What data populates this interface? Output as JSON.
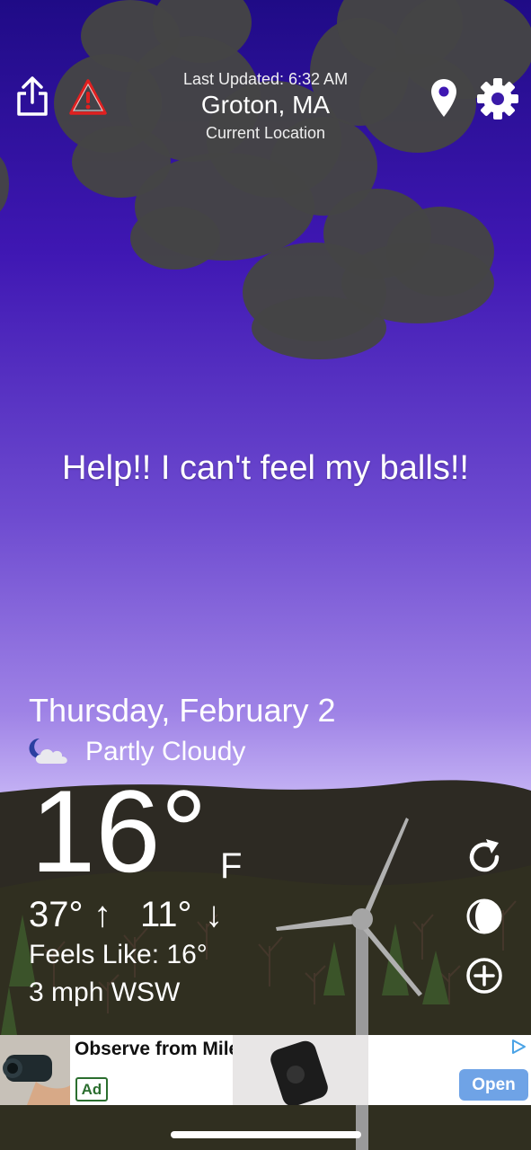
{
  "header": {
    "last_updated": "Last Updated: 6:32 AM",
    "city": "Groton, MA",
    "location_label": "Current Location"
  },
  "icons": {
    "share": "share-icon",
    "alert": "warning-triangle-icon",
    "location": "map-pin-icon",
    "settings": "gear-icon",
    "condition": "partly-cloudy-night-icon",
    "refresh": "refresh-icon",
    "moon": "moon-phase-icon",
    "add": "plus-circle-icon"
  },
  "main": {
    "message": "Help!! I can't feel my balls!!",
    "date": "Thursday, February 2",
    "condition": "Partly Cloudy",
    "temperature": "16°",
    "unit": "F",
    "high": "37°",
    "high_arrow": "↑",
    "low": "11°",
    "low_arrow": "↓",
    "feels_like": "Feels Like: 16°",
    "wind": "3 mph WSW"
  },
  "ad": {
    "headline": "Observe from Miles away",
    "badge": "Ad",
    "cta": "Open"
  },
  "colors": {
    "sky_top": "#1f0b86",
    "sky_bottom": "#d8cbf9",
    "cloud": "#454545",
    "ground": "#2d2a23",
    "alert_red": "#e02020",
    "ad_button": "#6fa3e6"
  }
}
